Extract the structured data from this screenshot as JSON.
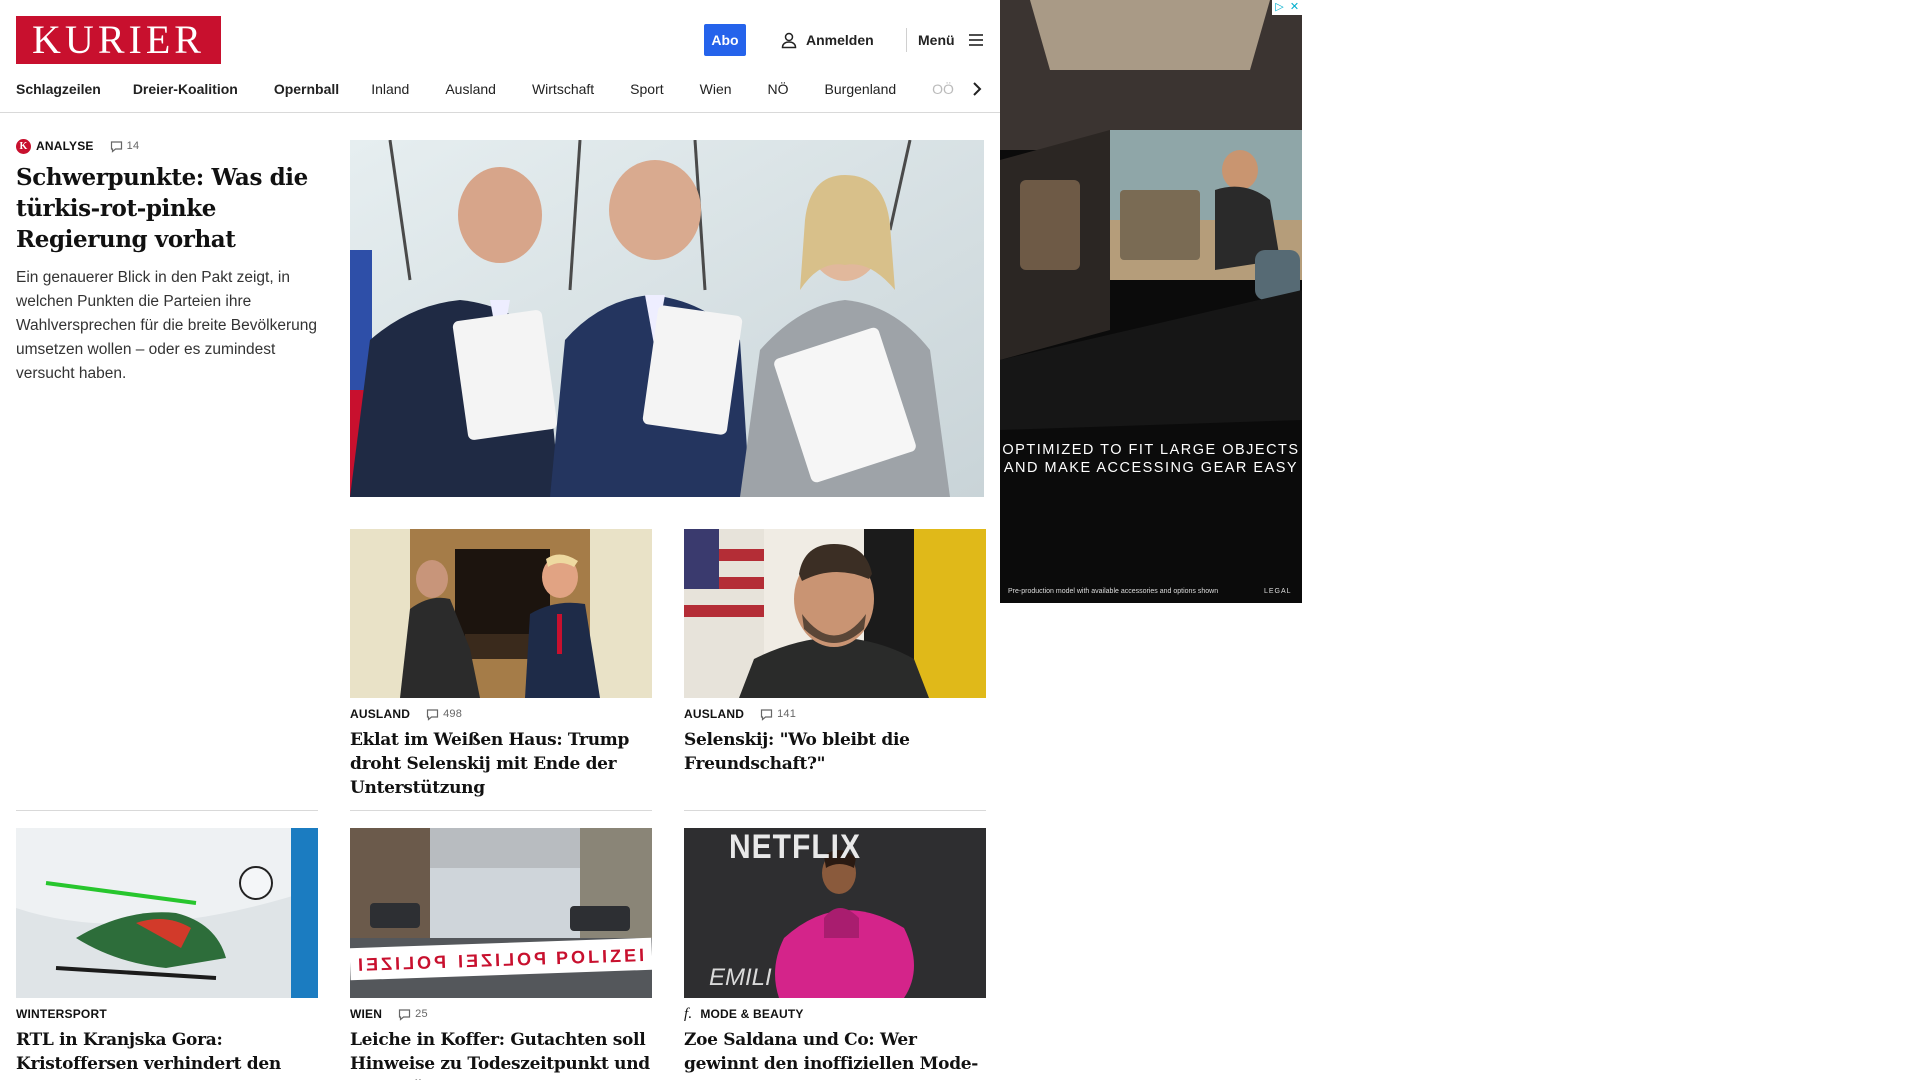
{
  "header": {
    "logo": "KURIER",
    "abo_label": "Abo",
    "login_label": "Anmelden",
    "menu_label": "Menü"
  },
  "nav": {
    "items": [
      {
        "label": "Schlagzeilen"
      },
      {
        "label": "Dreier-Koalition"
      },
      {
        "label": "Opernball"
      },
      {
        "label": "Inland"
      },
      {
        "label": "Ausland"
      },
      {
        "label": "Wirtschaft"
      },
      {
        "label": "Sport"
      },
      {
        "label": "Wien"
      },
      {
        "label": "NÖ"
      },
      {
        "label": "Burgenland"
      },
      {
        "label": "OÖ"
      }
    ]
  },
  "lead": {
    "badge": "K",
    "category": "ANALYSE",
    "comments": "14",
    "title": "Schwerpunkte: Was die türkis-rot-pinke Regierung vorhat",
    "teaser": "Ein genauerer Blick in den Pakt zeigt, in welchen Punkten die Parteien ihre Wahlversprechen für die breite Bevölkerung umsetzen wollen – oder es zumindest versucht haben."
  },
  "articles": [
    {
      "category": "AUSLAND",
      "comments": "498",
      "title": "Eklat im Weißen Haus: Trump droht Selenskij mit Ende der Unterstützung"
    },
    {
      "category": "AUSLAND",
      "comments": "141",
      "title": "Selenskij: \"Wo bleibt die Freundschaft?\""
    },
    {
      "category": "WINTERSPORT",
      "title": "RTL in Kranjska Gora: Kristoffersen verhindert den ersten brasilianischen Sieg"
    },
    {
      "category": "WIEN",
      "comments": "25",
      "title": "Leiche in Koffer: Gutachten soll Hinweise zu Todeszeitpunkt und Identität liefern"
    },
    {
      "category": "MODE & BEAUTY",
      "badge": "f.",
      "title": "Zoe Saldana und Co: Wer gewinnt den inoffiziellen Mode-Oscar?"
    }
  ],
  "image_text": {
    "police_tape": "POLIZEI",
    "police_tape_mirror": "IƎZI⅃OЯ",
    "netflix": "NETFLIX",
    "emilia": "EMILI"
  },
  "ad": {
    "close_icons": [
      "▷",
      "✕"
    ],
    "headline_1": "OPTIMIZED TO FIT LARGE OBJECTS",
    "headline_2": "AND MAKE ACCESSING GEAR EASY",
    "fine_print": "Pre-production model with available accessories and options shown",
    "legal": "LEGAL"
  },
  "colors": {
    "brand": "#c8102e",
    "abo": "#2563eb"
  }
}
